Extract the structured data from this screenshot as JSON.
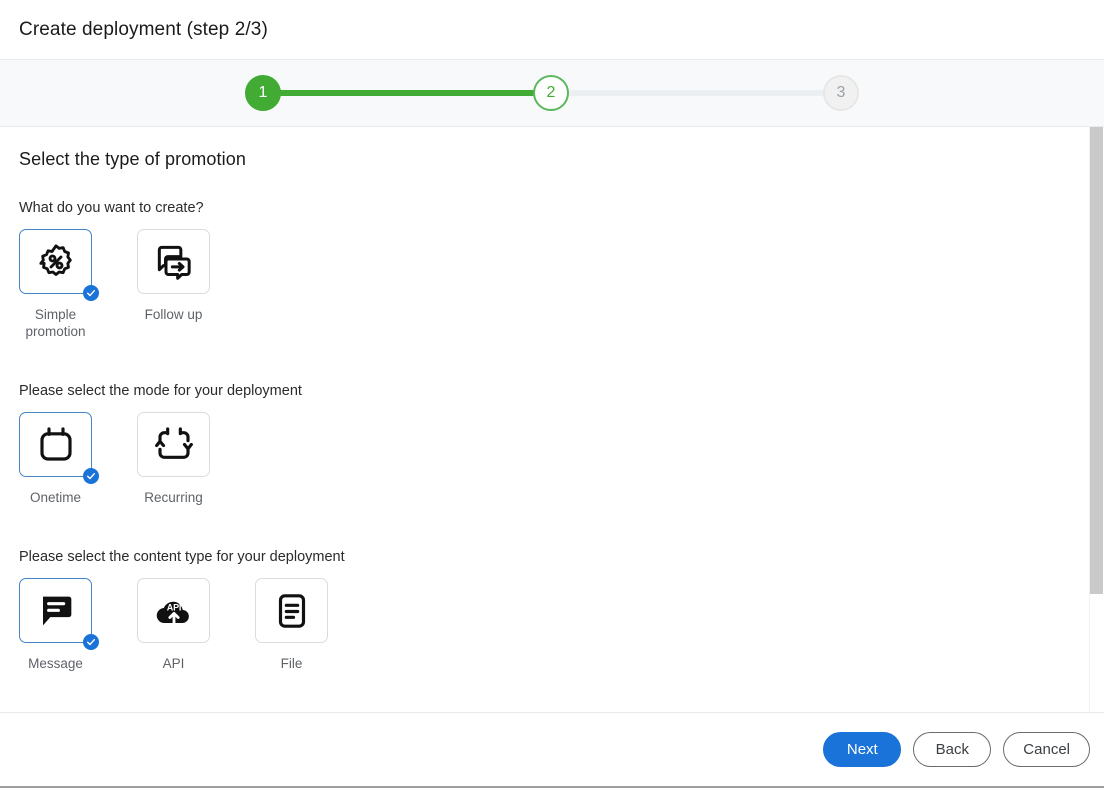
{
  "window": {
    "title": "Create deployment (step 2/3)"
  },
  "stepper": {
    "steps": [
      {
        "label": "1",
        "state": "completed"
      },
      {
        "label": "2",
        "state": "current"
      },
      {
        "label": "3",
        "state": "upcoming"
      }
    ],
    "active_color": "#41ab34",
    "inactive_color": "#eceff1"
  },
  "content": {
    "section_title": "Select the type of promotion",
    "groups": [
      {
        "question": "What do you want to create?",
        "options": [
          {
            "label": "Simple promotion",
            "icon": "percent-badge-icon",
            "selected": true
          },
          {
            "label": "Follow up",
            "icon": "follow-up-chat-icon",
            "selected": false
          }
        ]
      },
      {
        "question": "Please select the mode for your deployment",
        "options": [
          {
            "label": "Onetime",
            "icon": "calendar-icon",
            "selected": true
          },
          {
            "label": "Recurring",
            "icon": "recurring-cycle-icon",
            "selected": false
          }
        ]
      },
      {
        "question": "Please select the content type for your deployment",
        "options": [
          {
            "label": "Message",
            "icon": "message-bubble-icon",
            "selected": true
          },
          {
            "label": "API",
            "icon": "api-cloud-upload-icon",
            "selected": false
          },
          {
            "label": "File",
            "icon": "file-document-icon",
            "selected": false
          }
        ]
      }
    ]
  },
  "footer": {
    "next_label": "Next",
    "back_label": "Back",
    "cancel_label": "Cancel",
    "primary_color": "#1a73d8"
  }
}
